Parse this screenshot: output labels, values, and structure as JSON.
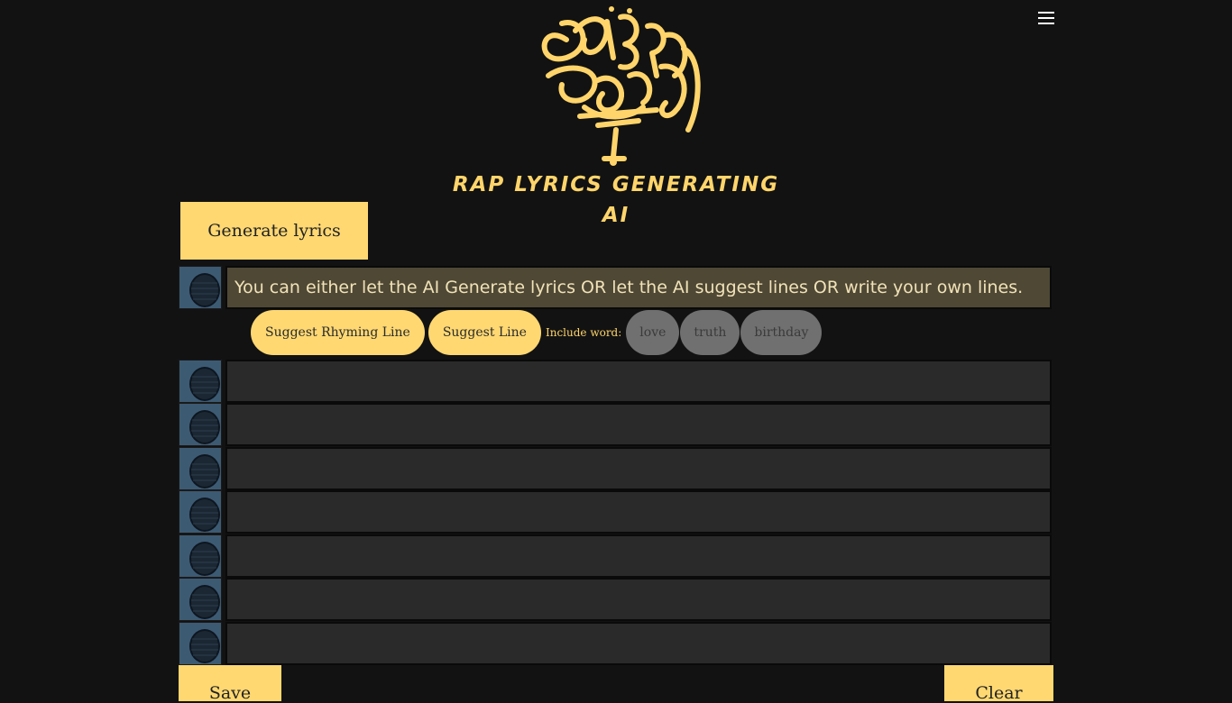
{
  "header": {
    "logo_icon": "deep-beat-graffiti-logo",
    "subtitle": "RAP LYRICS GENERATING AI",
    "menu_icon": "hamburger-menu-icon"
  },
  "actions": {
    "generate_label": "Generate lyrics",
    "save_label": "Save",
    "clear_label": "Clear"
  },
  "lines": {
    "first_placeholder": "You can either let the AI Generate lyrics OR let the AI suggest lines OR write your own lines.",
    "mic_icon": "microphone-icon"
  },
  "suggest": {
    "rhyming_label": "Suggest Rhyming Line",
    "line_label": "Suggest Line",
    "include_label": "Include word:",
    "words": [
      "love",
      "truth",
      "birthday"
    ]
  },
  "colors": {
    "accent": "#ffd872",
    "background": "#121212",
    "input_highlight": "#4f4835",
    "input_bg": "#2a2a2a",
    "chip_grey": "#707070"
  }
}
